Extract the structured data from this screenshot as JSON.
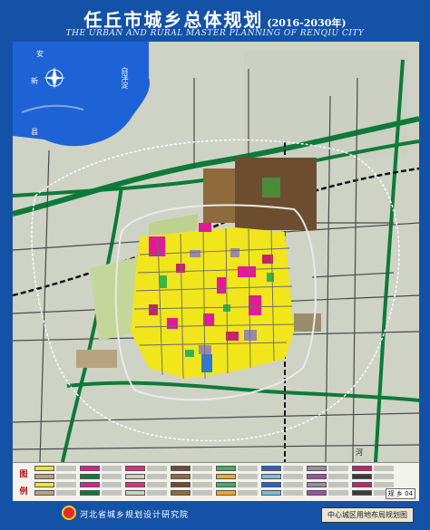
{
  "header": {
    "title_cn": "任丘市城乡总体规划",
    "years": "(2016-2030年)",
    "title_en": "THE URBAN AND RURAL MASTER PLANNING OF RENQIU CITY"
  },
  "map": {
    "labels": {
      "place_a": "安",
      "place_b": "新",
      "lake": "白洋淀",
      "place_c": "县",
      "river_he": "河"
    },
    "colors": {
      "water": "#1e63d6",
      "farmland": "#c9ccbd",
      "residential": "#f1e51c",
      "commercial": "#e5189a",
      "public": "#d8327c",
      "industrial": "#6d4d2f",
      "green": "#38b54a",
      "expressway": "#0d7a3a",
      "road": "#3a3a3a",
      "rail": "#111111",
      "boundary": "#ffffff"
    },
    "icons": [
      "north-arrow-icon"
    ]
  },
  "legend": {
    "head": [
      "图",
      "例"
    ],
    "code": "规 乡 04"
  },
  "footer": {
    "institute": "河北省城乡规划设计研究院",
    "map_name": "中心城区用地布局规划图"
  }
}
